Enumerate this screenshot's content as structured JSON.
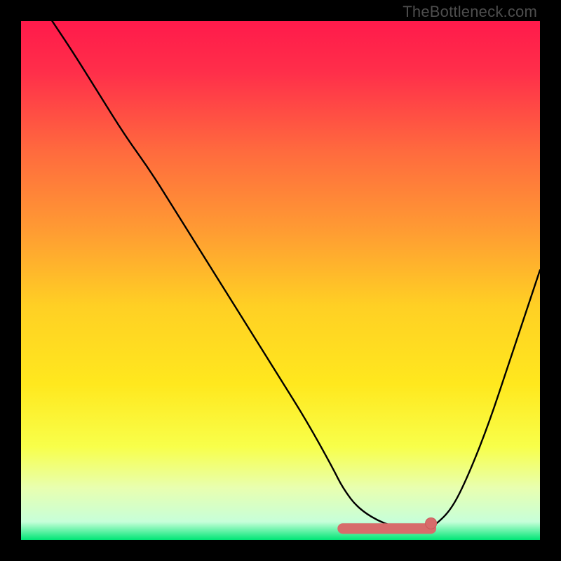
{
  "watermark": "TheBottleneck.com",
  "colors": {
    "gradient_stops": [
      {
        "offset": 0.0,
        "color": "#ff1a4b"
      },
      {
        "offset": 0.1,
        "color": "#ff2f4a"
      },
      {
        "offset": 0.25,
        "color": "#ff6a3e"
      },
      {
        "offset": 0.4,
        "color": "#ff9a33"
      },
      {
        "offset": 0.55,
        "color": "#ffd024"
      },
      {
        "offset": 0.7,
        "color": "#ffe81e"
      },
      {
        "offset": 0.82,
        "color": "#f8ff4a"
      },
      {
        "offset": 0.9,
        "color": "#e8ffb0"
      },
      {
        "offset": 0.965,
        "color": "#c7ffd9"
      },
      {
        "offset": 1.0,
        "color": "#00e676"
      }
    ],
    "curve": "#000000",
    "marker_fill": "#d76b6b",
    "marker_stroke": "#c95a5a"
  },
  "chart_data": {
    "type": "line",
    "title": "",
    "xlabel": "",
    "ylabel": "",
    "xlim": [
      0,
      100
    ],
    "ylim": [
      0,
      100
    ],
    "grid": false,
    "legend": false,
    "series": [
      {
        "name": "bottleneck-curve",
        "x": [
          6,
          10,
          15,
          20,
          25,
          30,
          35,
          40,
          45,
          50,
          55,
          60,
          62,
          65,
          70,
          75,
          78,
          80,
          83,
          86,
          90,
          94,
          98,
          100
        ],
        "y": [
          100,
          94,
          86,
          78,
          71,
          63,
          55,
          47,
          39,
          31,
          23,
          14,
          10,
          6,
          3,
          2,
          2,
          3,
          6,
          12,
          22,
          34,
          46,
          52
        ]
      }
    ],
    "markers": {
      "name": "optimal-band",
      "shape": "rounded-segment",
      "x_start": 62,
      "x_end": 79,
      "y": 2.2,
      "end_dot_x": 79,
      "end_dot_y": 3.2
    }
  }
}
